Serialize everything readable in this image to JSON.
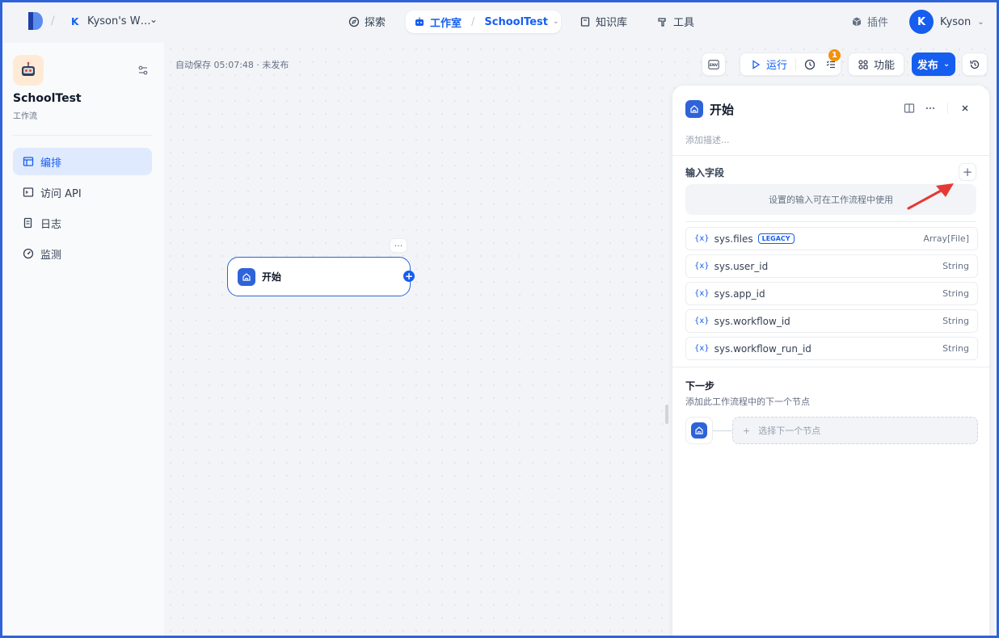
{
  "topnav": {
    "workspace_initial": "K",
    "workspace_name": "Kyson's W…",
    "explore": "探索",
    "studio": "工作室",
    "app_crumb": "SchoolTest",
    "knowledge": "知识库",
    "tools": "工具",
    "plugins": "插件",
    "user_initial": "K",
    "user_name": "Kyson"
  },
  "sidebar": {
    "app_name": "SchoolTest",
    "app_type": "工作流",
    "items": [
      {
        "label": "编排",
        "icon": "layout-icon",
        "active": true
      },
      {
        "label": "访问 API",
        "icon": "terminal-icon",
        "active": false
      },
      {
        "label": "日志",
        "icon": "log-icon",
        "active": false
      },
      {
        "label": "监测",
        "icon": "monitor-icon",
        "active": false
      }
    ]
  },
  "canvas": {
    "autosave": "自动保存 05:07:48 · 未发布",
    "toolbar": {
      "env": "ENV",
      "run": "运行",
      "checklist_badge": "1",
      "features": "功能",
      "publish": "发布"
    },
    "node": {
      "title": "开始",
      "more": "···"
    }
  },
  "panel": {
    "title": "开始",
    "description_placeholder": "添加描述...",
    "input_fields_title": "输入字段",
    "add_symbol": "+",
    "input_hint": "设置的输入可在工作流程中使用",
    "variables": [
      {
        "name": "sys.files",
        "badge": "LEGACY",
        "type": "Array[File]"
      },
      {
        "name": "sys.user_id",
        "badge": "",
        "type": "String"
      },
      {
        "name": "sys.app_id",
        "badge": "",
        "type": "String"
      },
      {
        "name": "sys.workflow_id",
        "badge": "",
        "type": "String"
      },
      {
        "name": "sys.workflow_run_id",
        "badge": "",
        "type": "String"
      }
    ],
    "var_icon": "{x}",
    "next_title": "下一步",
    "next_desc": "添加此工作流程中的下一个节点",
    "next_select": "选择下一个节点"
  },
  "colors": {
    "accent": "#155eef",
    "node_icon": "#2e63d9",
    "badge": "#f79009",
    "annotation_arrow": "#e53935"
  }
}
